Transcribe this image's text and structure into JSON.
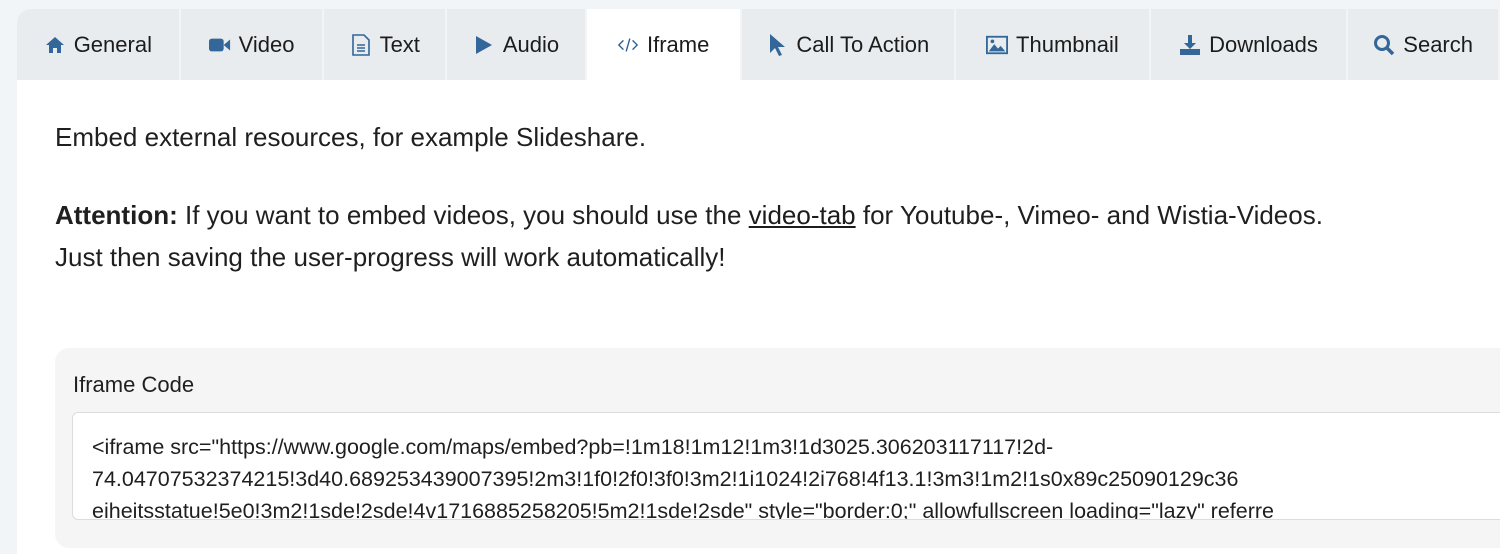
{
  "tabs": [
    {
      "label": "General",
      "icon": "home-icon"
    },
    {
      "label": "Video",
      "icon": "video-camera-icon"
    },
    {
      "label": "Text",
      "icon": "document-icon"
    },
    {
      "label": "Audio",
      "icon": "play-icon"
    },
    {
      "label": "Iframe",
      "icon": "code-icon",
      "active": true
    },
    {
      "label": "Call To Action",
      "icon": "cursor-icon"
    },
    {
      "label": "Thumbnail",
      "icon": "image-icon"
    },
    {
      "label": "Downloads",
      "icon": "download-icon"
    },
    {
      "label": "Search",
      "icon": "search-icon"
    }
  ],
  "content": {
    "intro": "Embed external resources, for example Slideshare.",
    "attention_label": "Attention:",
    "attention_before": " If you want to embed videos, you should use the ",
    "attention_link": "video-tab",
    "attention_after": " for Youtube-, Vimeo- and Wistia-Videos.",
    "attention_line2": "Just then saving the user-progress will work automatically!"
  },
  "iframe_field": {
    "label": "Iframe Code",
    "value_lines": [
      "<iframe src=\"https://www.google.com/maps/embed?pb=!1m18!1m12!1m3!1d3025.306203117117!2d-",
      "74.04707532374215!3d40.689253439007395!2m3!1f0!2f0!3f0!3m2!1i1024!2i768!4f13.1!3m3!1m2!1s0x89c25090129c36",
      "eiheitsstatue!5e0!3m2!1sde!2sde!4v1716885258205!5m2!1sde!2sde\" style=\"border:0;\" allowfullscreen loading=\"lazy\" referre"
    ]
  }
}
